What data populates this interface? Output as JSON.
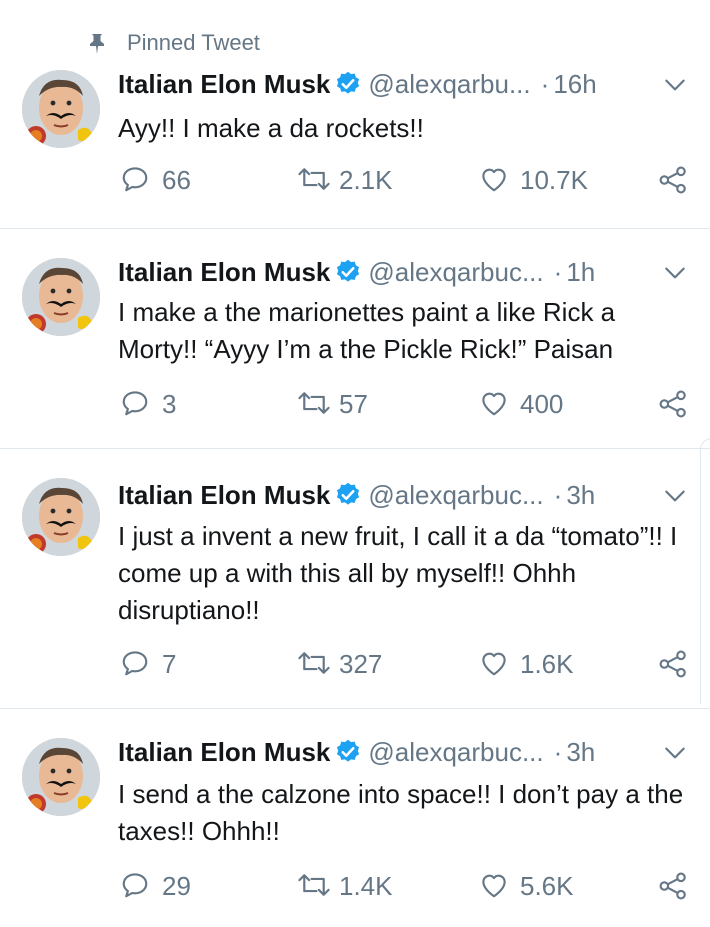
{
  "pinned_label": "Pinned Tweet",
  "colors": {
    "text": "#14171a",
    "secondary": "#657786",
    "verified": "#1da1f2",
    "divider": "#e1e8ed"
  },
  "tweets": [
    {
      "name": "Italian Elon Musk",
      "handle": "@alexqarbu...",
      "dot": "·",
      "time": "16h",
      "text": "Ayy!! I make a da rockets!!",
      "replies": "66",
      "retweets": "2.1K",
      "likes": "10.7K"
    },
    {
      "name": "Italian Elon Musk",
      "handle": "@alexqarbuc...",
      "dot": "·",
      "time": "1h",
      "text": "I make a the marionettes paint a like Rick a Morty!! “Ayyy I’m a the Pickle Rick!” Paisan",
      "replies": "3",
      "retweets": "57",
      "likes": "400"
    },
    {
      "name": "Italian Elon Musk",
      "handle": "@alexqarbuc...",
      "dot": "·",
      "time": "3h",
      "text": "I just a invent a new fruit, I call it a da “tomato”!! I come up a with this all by myself!! Ohhh disruptiano!!",
      "replies": "7",
      "retweets": "327",
      "likes": "1.6K"
    },
    {
      "name": "Italian Elon Musk",
      "handle": "@alexqarbuc...",
      "dot": "·",
      "time": "3h",
      "text": "I send a the calzone into space!! I don’t pay a the taxes!! Ohhh!!",
      "replies": "29",
      "retweets": "1.4K",
      "likes": "5.6K"
    }
  ]
}
